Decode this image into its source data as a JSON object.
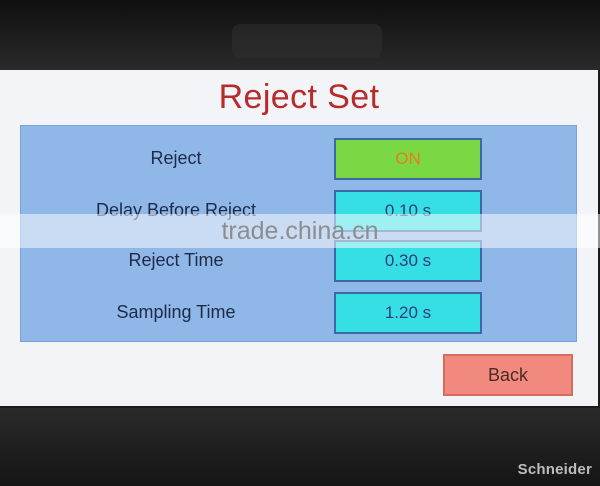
{
  "screen": {
    "title": "Reject Set"
  },
  "settings": {
    "rows": [
      {
        "label": "Reject",
        "value": "ON"
      },
      {
        "label": "Delay Before Reject",
        "value": "0.10 s"
      },
      {
        "label": "Reject Time",
        "value": "0.30 s"
      },
      {
        "label": "Sampling Time",
        "value": "1.20 s"
      }
    ]
  },
  "buttons": {
    "back": "Back"
  },
  "overlay": {
    "watermark": "trade.china.cn"
  },
  "bezel": {
    "brand": "Schneider"
  },
  "colors": {
    "title": "#b72b2b",
    "panel": "#8fb7e8",
    "toggle_bg": "#79d843",
    "toggle_text": "#f07b16",
    "value_bg": "#35dfe3",
    "back_bg": "#f1897e"
  }
}
